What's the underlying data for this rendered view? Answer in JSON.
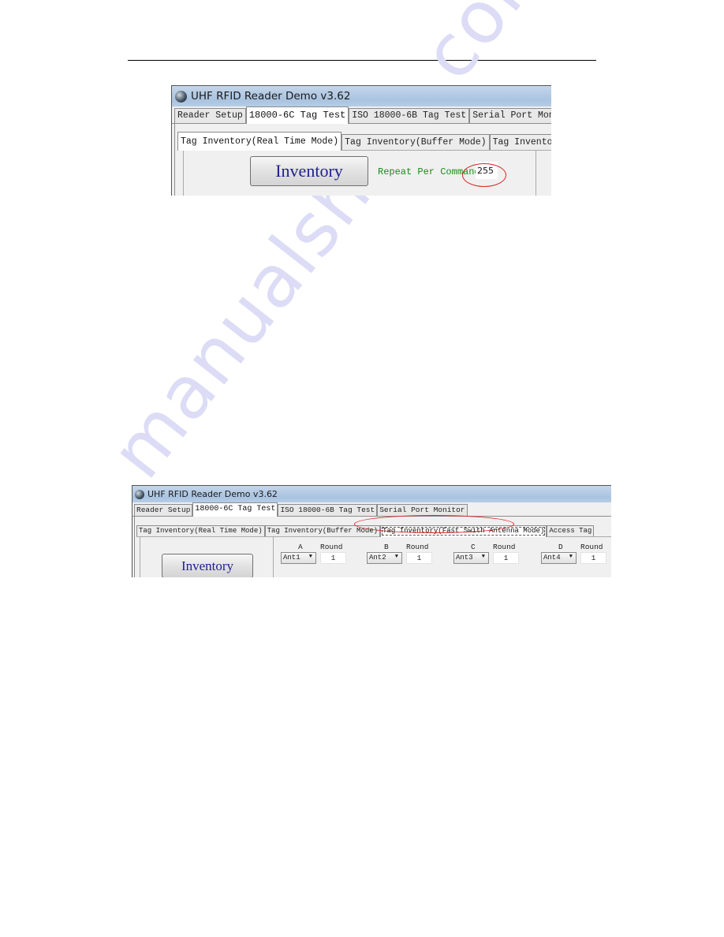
{
  "watermark": "manualshive.com",
  "screenshot_1": {
    "window_title": "UHF RFID Reader Demo v3.62",
    "main_tabs": [
      {
        "label": "Reader Setup",
        "active": false
      },
      {
        "label": "18000-6C Tag Test",
        "active": true
      },
      {
        "label": "ISO 18000-6B Tag Test",
        "active": false
      },
      {
        "label": "Serial Port Monitor",
        "active": false
      }
    ],
    "sub_tabs": [
      {
        "label": "Tag Inventory(Real Time Mode)",
        "active": true
      },
      {
        "label": "Tag Inventory(Buffer Mode)",
        "active": false
      },
      {
        "label": "Tag Inventory(Fas",
        "active": false
      }
    ],
    "inventory_button": "Inventory",
    "repeat_label": "Repeat Per Command",
    "repeat_value": "255",
    "annotation_color": "#d22222"
  },
  "screenshot_2": {
    "window_title": "UHF RFID Reader Demo v3.62",
    "main_tabs": [
      {
        "label": "Reader Setup",
        "active": false
      },
      {
        "label": "18000-6C Tag Test",
        "active": true
      },
      {
        "label": "ISO 18000-6B Tag Test",
        "active": false
      },
      {
        "label": "Serial Port Monitor",
        "active": false
      }
    ],
    "sub_tabs": [
      {
        "label": "Tag Inventory(Real Time Mode)",
        "active": false
      },
      {
        "label": "Tag Inventory(Buffer Mode)",
        "active": false
      },
      {
        "label": "Tag Inventory(Fast Swith Antenna Mode)",
        "active": true
      },
      {
        "label": "Access Tag",
        "active": false
      }
    ],
    "inventory_button": "Inventory",
    "round_label": "Round",
    "antennas": [
      {
        "letter": "A",
        "selected": "Ant1",
        "round": "1"
      },
      {
        "letter": "B",
        "selected": "Ant2",
        "round": "1"
      },
      {
        "letter": "C",
        "selected": "Ant3",
        "round": "1"
      },
      {
        "letter": "D",
        "selected": "Ant4",
        "round": "1"
      }
    ],
    "dropdown_arrow": "▼"
  }
}
